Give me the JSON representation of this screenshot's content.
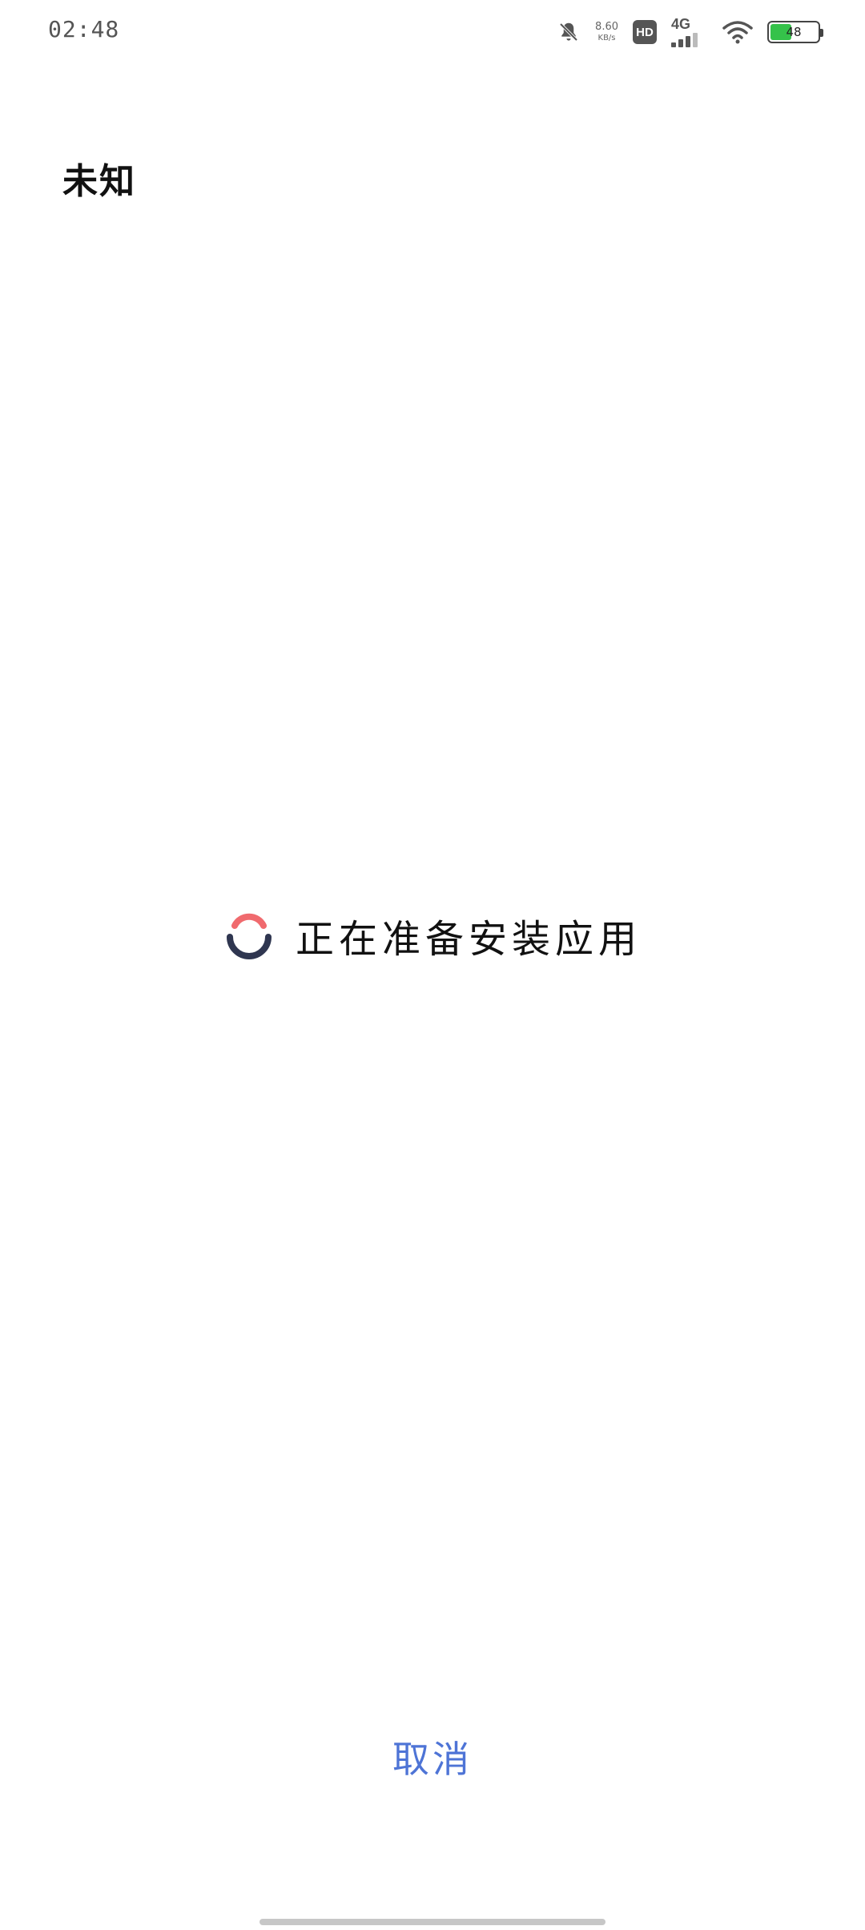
{
  "status_bar": {
    "time": "02:48",
    "net_speed_value": "8.60",
    "net_speed_unit": "KB/s",
    "hd_label": "HD",
    "network_label": "4G",
    "battery_level": 48,
    "battery_label": "48",
    "icons": {
      "silent": "bell-off-icon",
      "wifi": "wifi-icon",
      "battery": "battery-icon"
    }
  },
  "app": {
    "name": "未知"
  },
  "install": {
    "status_text": "正在准备安装应用",
    "spinner_colors": {
      "top": "#f06a6e",
      "bottom": "#2f3650"
    }
  },
  "actions": {
    "cancel_label": "取消"
  },
  "colors": {
    "accent": "#4e74d6",
    "battery_fill": "#35c24a"
  }
}
